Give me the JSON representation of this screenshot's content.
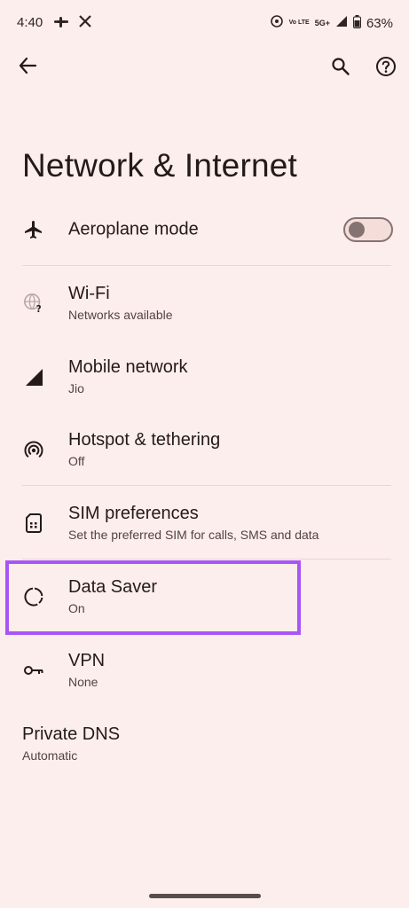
{
  "status_bar": {
    "time": "4:40",
    "network_label": "5G+",
    "volte_label": "Vo LTE",
    "battery": "63%"
  },
  "toolbar": {
    "back_icon": "arrow-back-icon",
    "search_icon": "search-icon",
    "help_icon": "help-icon"
  },
  "page": {
    "title": "Network & Internet"
  },
  "items": [
    {
      "title": "Aeroplane mode",
      "summary": "",
      "icon": "airplane-icon",
      "toggle_on": false
    },
    {
      "title": "Wi-Fi",
      "summary": "Networks available",
      "icon": "wifi-question-icon"
    },
    {
      "title": "Mobile network",
      "summary": "Jio",
      "icon": "signal-icon"
    },
    {
      "title": "Hotspot & tethering",
      "summary": "Off",
      "icon": "hotspot-icon"
    },
    {
      "title": "SIM preferences",
      "summary": "Set the preferred SIM for calls, SMS and data",
      "icon": "sim-card-icon"
    },
    {
      "title": "Data Saver",
      "summary": "On",
      "icon": "data-saver-icon",
      "highlighted": true
    },
    {
      "title": "VPN",
      "summary": "None",
      "icon": "vpn-key-icon"
    },
    {
      "title": "Private DNS",
      "summary": "Automatic"
    }
  ],
  "colors": {
    "background": "#FCEEEC",
    "text_primary": "#231A19",
    "text_secondary": "#534342",
    "highlight": "#A855F7"
  }
}
